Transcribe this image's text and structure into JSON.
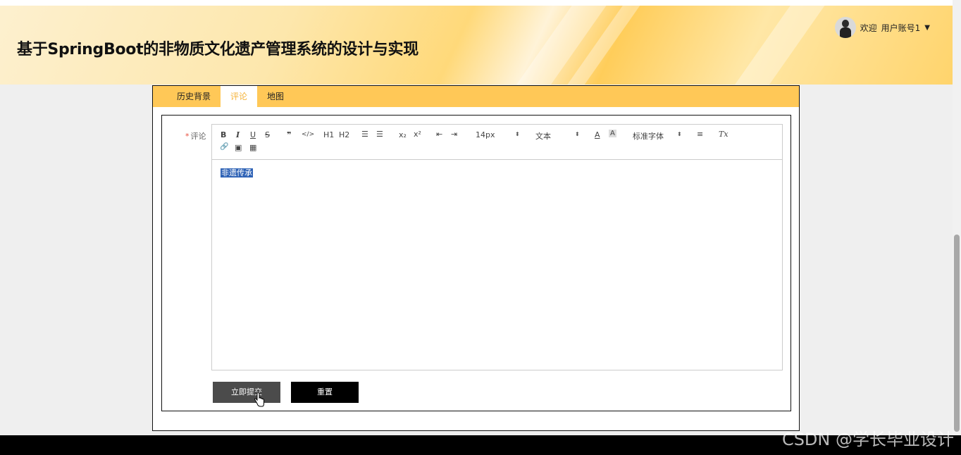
{
  "header": {
    "title": "基于SpringBoot的非物质文化遗产管理系统的设计与实现",
    "welcome": "欢迎",
    "username": "用户账号1",
    "caret": "▼"
  },
  "tabs": [
    {
      "label": "历史背景",
      "active": false
    },
    {
      "label": "评论",
      "active": true
    },
    {
      "label": "地图",
      "active": false
    }
  ],
  "form": {
    "required_mark": "*",
    "comment_label": "评论",
    "editor": {
      "content": "非遗传承",
      "content_selected": true,
      "toolbar": {
        "bold": "B",
        "italic": "I",
        "underline": "U",
        "strike": "S",
        "blockquote": "❞",
        "code": "</>",
        "h1": "H1",
        "h2": "H2",
        "ordered_list": "☰",
        "bullet_list": "☰",
        "subscript": "x₂",
        "superscript": "x²",
        "outdent": "⇤",
        "indent": "⇥",
        "size": "14px",
        "header": "文本",
        "color": "A",
        "background": "A",
        "font": "标准字体",
        "align": "≡",
        "clean": "Tx",
        "link": "🔗",
        "image": "▣",
        "video": "▦"
      }
    },
    "submit_label": "立即提交",
    "reset_label": "重置"
  },
  "watermark": "CSDN @学长毕业设计",
  "colors": {
    "tab_bar": "#ffc857",
    "active_tab_text": "#f5b53e",
    "submit_bg": "#4b4b4b",
    "reset_bg": "#000000",
    "selection": "#2f63b6"
  }
}
